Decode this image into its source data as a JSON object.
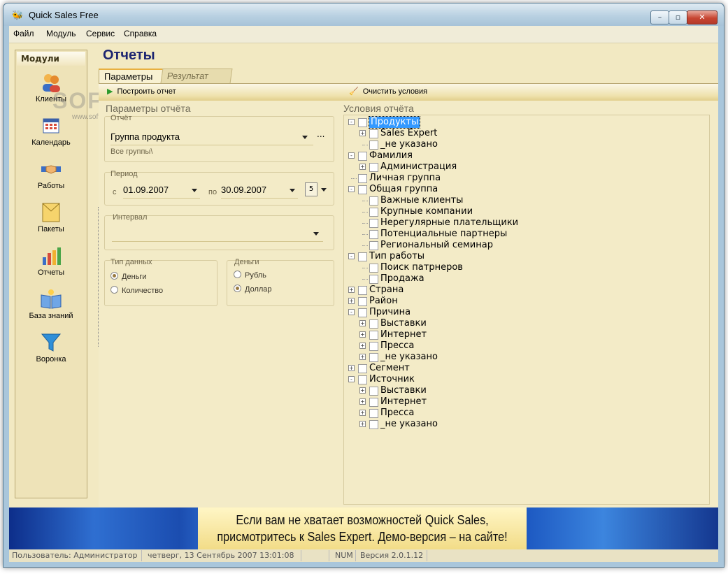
{
  "window": {
    "title": "Quick Sales Free"
  },
  "menu": [
    "Файл",
    "Модуль",
    "Сервис",
    "Справка"
  ],
  "sidebar": {
    "title": "Модули",
    "items": [
      {
        "label": "Клиенты",
        "icon": "clients-icon"
      },
      {
        "label": "Календарь",
        "icon": "calendar-icon"
      },
      {
        "label": "Работы",
        "icon": "handshake-icon"
      },
      {
        "label": "Пакеты",
        "icon": "package-icon"
      },
      {
        "label": "Отчеты",
        "icon": "bar-chart-icon"
      },
      {
        "label": "База знаний",
        "icon": "book-icon"
      },
      {
        "label": "Воронка",
        "icon": "funnel-icon"
      }
    ]
  },
  "page": {
    "title": "Отчеты"
  },
  "tabs": [
    "Параметры",
    "Результат"
  ],
  "toolbar": {
    "build": "Построить отчет",
    "clear": "Очистить условия"
  },
  "params": {
    "section_title": "Параметры отчёта",
    "report_label": "Отчёт",
    "report_value": "Группа продукта",
    "report_more": "...",
    "report_hint": "Все группы\\",
    "period_label": "Период",
    "from_label": "с",
    "from_value": "01.09.2007",
    "to_label": "по",
    "to_value": "30.09.2007",
    "interval_label": "Интервал",
    "interval_value": "",
    "datatype_label": "Тип данных",
    "datatype_options": [
      "Деньги",
      "Количество"
    ],
    "datatype_selected": "Деньги",
    "money_label": "Деньги",
    "money_options": [
      "Рубль",
      "Доллар"
    ],
    "money_selected": "Доллар"
  },
  "conditions": {
    "title": "Условия отчёта",
    "tree": [
      {
        "label": "Продукты",
        "level": 0,
        "exp": "-",
        "selected": true
      },
      {
        "label": "Sales Expert",
        "level": 1,
        "exp": "+"
      },
      {
        "label": "_не указано",
        "level": 1,
        "exp": ""
      },
      {
        "label": "Фамилия",
        "level": 0,
        "exp": "-"
      },
      {
        "label": "Администрация",
        "level": 1,
        "exp": "+"
      },
      {
        "label": "Личная группа",
        "level": 0,
        "exp": ""
      },
      {
        "label": "Общая группа",
        "level": 0,
        "exp": "-"
      },
      {
        "label": "Важные клиенты",
        "level": 1,
        "exp": ""
      },
      {
        "label": "Крупные компании",
        "level": 1,
        "exp": ""
      },
      {
        "label": "Нерегулярные плательщики",
        "level": 1,
        "exp": ""
      },
      {
        "label": "Потенциальные партнеры",
        "level": 1,
        "exp": ""
      },
      {
        "label": "Региональный семинар",
        "level": 1,
        "exp": ""
      },
      {
        "label": "Тип работы",
        "level": 0,
        "exp": "-"
      },
      {
        "label": "Поиск патрнеров",
        "level": 1,
        "exp": ""
      },
      {
        "label": "Продажа",
        "level": 1,
        "exp": ""
      },
      {
        "label": "Страна",
        "level": 0,
        "exp": "+"
      },
      {
        "label": "Район",
        "level": 0,
        "exp": "+"
      },
      {
        "label": "Причина",
        "level": 0,
        "exp": "-"
      },
      {
        "label": "Выставки",
        "level": 1,
        "exp": "+"
      },
      {
        "label": "Интернет",
        "level": 1,
        "exp": "+"
      },
      {
        "label": "Пресса",
        "level": 1,
        "exp": "+"
      },
      {
        "label": "_не указано",
        "level": 1,
        "exp": "+"
      },
      {
        "label": "Сегмент",
        "level": 0,
        "exp": "+"
      },
      {
        "label": "Источник",
        "level": 0,
        "exp": "-"
      },
      {
        "label": "Выставки",
        "level": 1,
        "exp": "+"
      },
      {
        "label": "Интернет",
        "level": 1,
        "exp": "+"
      },
      {
        "label": "Пресса",
        "level": 1,
        "exp": "+"
      },
      {
        "label": "_не указано",
        "level": 1,
        "exp": "+"
      }
    ]
  },
  "banner": {
    "line1": "Если вам не хватает возможностей Quick Sales,",
    "line2": "присмотритесь к Sales Expert. Демо-версия – на сайте!"
  },
  "status": {
    "user": "Пользователь: Администратор",
    "datetime": "четверг, 13 Сентябрь 2007 13:01:08",
    "num": "NUM",
    "version": "Версия 2.0.1.12"
  },
  "watermark": {
    "text": "SOFTPORTAL",
    "url": "www.softportal.com"
  }
}
